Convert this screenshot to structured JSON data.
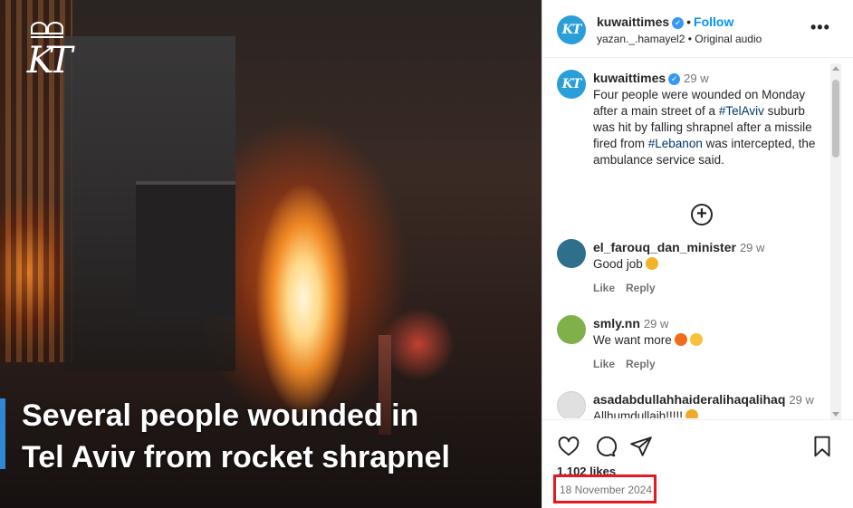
{
  "media": {
    "headline_line1": "Several people wounded in",
    "headline_line2": "Tel Aviv from rocket shrapnel",
    "watermark_logo": "KT"
  },
  "post_header": {
    "avatar_text": "KT",
    "username": "kuwaittimes",
    "follow_label": "Follow",
    "audio_line": "yazan._.hamayel2 • Original audio",
    "more_icon": "more-horizontal-icon"
  },
  "caption": {
    "avatar_text": "KT",
    "username": "kuwaittimes",
    "time": "29 w",
    "text_part1": "Four people were wounded on Monday after a main street of a ",
    "hashtag1": "#TelAviv",
    "text_part2": " suburb was hit by falling shrapnel after a missile fired from ",
    "hashtag2": "#Lebanon",
    "text_part3": " was intercepted, the ambulance service said.",
    "load_more_icon": "plus-circle-icon"
  },
  "comments": [
    {
      "username": "el_farouq_dan_minister",
      "time": "29 w",
      "text": "Good job",
      "emoji": "thumbs-up",
      "like_label": "Like",
      "reply_label": "Reply",
      "avatar_color": "#2e6f8c"
    },
    {
      "username": "smly.nn",
      "time": "29 w",
      "text": "We want more",
      "emoji": "fire smiling-face",
      "like_label": "Like",
      "reply_label": "Reply",
      "avatar_color": "#7fb04a"
    },
    {
      "username": "asadabdullahhaideralihaqalihaq",
      "time": "29 w",
      "text": "Allhumdullaih!!!!!",
      "emoji": "raised-hands",
      "avatar_color": "#d9d9d9"
    }
  ],
  "actions": {
    "like_icon": "heart-icon",
    "comment_icon": "comment-icon",
    "share_icon": "send-icon",
    "save_icon": "bookmark-icon",
    "likes_text": "1,102 likes",
    "date": "18 November 2024"
  },
  "colors": {
    "accent_link": "#0095f6",
    "hashtag": "#00376b",
    "highlight_box": "#e21b23",
    "headline_bar": "#2f87d6"
  }
}
